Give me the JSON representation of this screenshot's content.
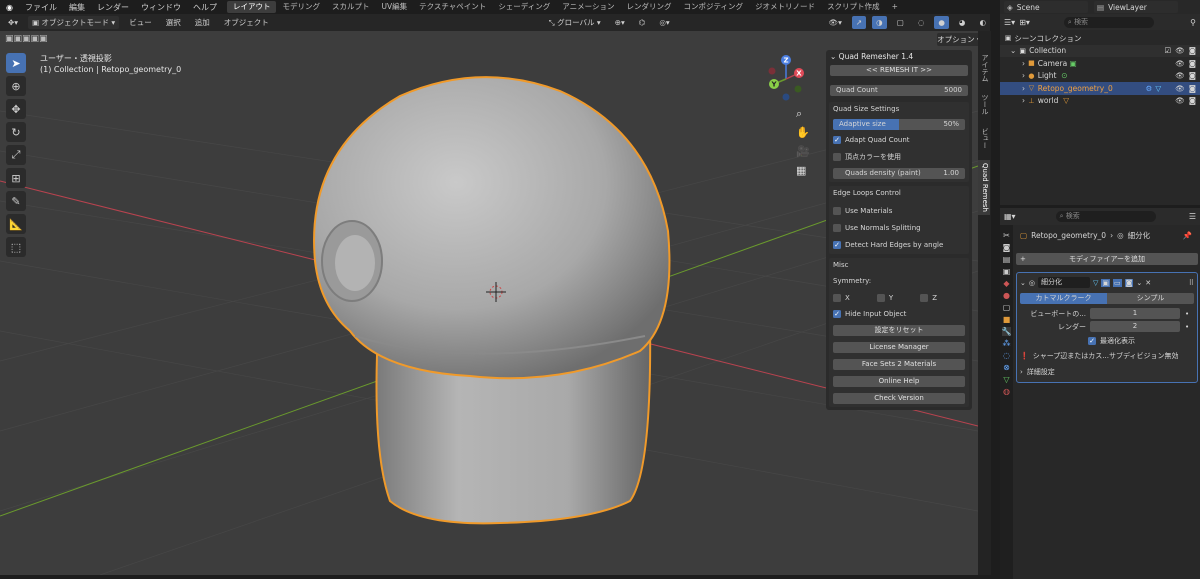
{
  "menubar": {
    "items": [
      "ファイル",
      "編集",
      "レンダー",
      "ウィンドウ",
      "ヘルプ"
    ],
    "workspaces": [
      "レイアウト",
      "モデリング",
      "スカルプト",
      "UV編集",
      "テクスチャペイント",
      "シェーディング",
      "アニメーション",
      "レンダリング",
      "コンポジティング",
      "ジオメトリノード",
      "スクリプト作成"
    ],
    "add_tab": "+",
    "scene": "Scene",
    "view_layer": "ViewLayer"
  },
  "viewport_header": {
    "mode": "オブジェクトモード",
    "menus": [
      "ビュー",
      "選択",
      "追加",
      "オブジェクト"
    ],
    "orientation": "グローバル",
    "options": "オプション"
  },
  "viewport": {
    "view_name": "ユーザー・透視投影",
    "collection_info": "(1) Collection | Retopo_geometry_0"
  },
  "sidebar_tabs": [
    "アイテム",
    "ツール",
    "ビュー",
    "Quad Remesh"
  ],
  "quad_remesher": {
    "title": "Quad Remesher 1.4",
    "remesh_button": "<< REMESH IT >>",
    "quad_count_label": "Quad Count",
    "quad_count_value": "5000",
    "quad_size_settings": "Quad Size Settings",
    "adaptive_size_label": "Adaptive size",
    "adaptive_size_value": "50%",
    "adaptive_size_fraction": 0.5,
    "adapt_quad_count": "Adapt Quad Count",
    "use_vertex_color": "頂点カラーを使用",
    "quads_density_label": "Quads density (paint)",
    "quads_density_value": "1.00",
    "edge_loops_control": "Edge Loops Control",
    "use_materials": "Use Materials",
    "use_normals_splitting": "Use Normals Splitting",
    "detect_hard_edges": "Detect Hard Edges by angle",
    "misc": "Misc",
    "symmetry": "Symmetry:",
    "sym_x": "X",
    "sym_y": "Y",
    "sym_z": "Z",
    "hide_input_object": "Hide Input Object",
    "reset_settings": "設定をリセット",
    "license_manager": "License Manager",
    "face_sets_2_materials": "Face Sets 2 Materials",
    "online_help": "Online Help",
    "check_version": "Check Version"
  },
  "outliner": {
    "search_placeholder": "検索",
    "scene_collection": "シーンコレクション",
    "items": [
      {
        "name": "Collection",
        "icon": "collection-icon"
      },
      {
        "name": "Camera",
        "icon": "camera-icon"
      },
      {
        "name": "Light",
        "icon": "light-icon"
      },
      {
        "name": "Retopo_geometry_0",
        "icon": "mesh-icon"
      },
      {
        "name": "world",
        "icon": "empty-icon"
      }
    ]
  },
  "properties": {
    "search_placeholder": "検索",
    "breadcrumb_object": "Retopo_geometry_0",
    "breadcrumb_modifier": "細分化",
    "add_modifier": "モディファイアーを追加",
    "modifier_name": "細分化",
    "catmull_clark": "カトマルクラーク",
    "simple": "シンプル",
    "viewport_label": "ビューポートの...",
    "viewport_value": "1",
    "render_label": "レンダー",
    "render_value": "2",
    "optimal_display": "最適化表示",
    "warning": "シャープ辺またはカス...サブディビジョン無効",
    "advanced": "詳細設定"
  },
  "colors": {
    "accent": "#4772b3",
    "selection_outline": "#f09a2a",
    "x_axis": "#b9434f",
    "y_axis": "#6a9a2d"
  }
}
